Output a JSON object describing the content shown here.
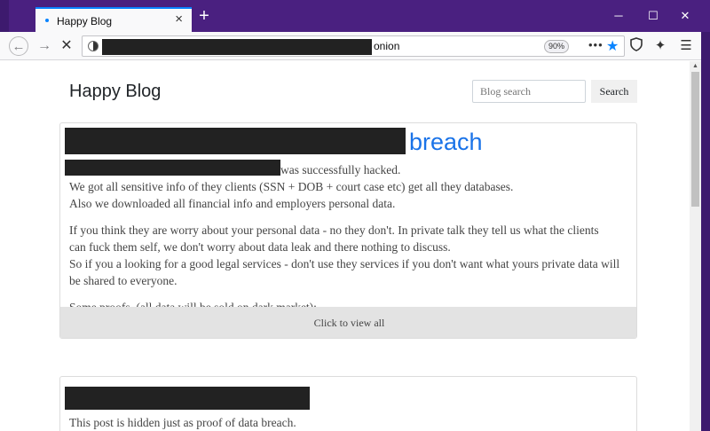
{
  "browser": {
    "tab_title": "Happy Blog",
    "new_tab_symbol": "+",
    "url_suffix": "onion",
    "zoom_level": "90%",
    "icons": [
      "back-icon",
      "forward-icon",
      "stop-icon",
      "site-info-icon",
      "page-actions-icon",
      "bookmark-star-icon",
      "tracking-shield-icon",
      "extension-icon",
      "menu-icon",
      "minimize-icon",
      "maximize-icon",
      "close-icon"
    ]
  },
  "header": {
    "title": "Happy Blog",
    "search_placeholder": "Blog search",
    "search_button": "Search"
  },
  "posts": [
    {
      "title_suffix": "breach",
      "hacked_line": "was successfully hacked.",
      "lines": [
        "We got all sensitive info of they clients (SSN + DOB + court case etc) get all they databases.",
        "Also we downloaded all financial info and employers personal data.",
        "If you think they are worry about your personal data - no they don't. In private talk they tell us what the clients",
        "can fuck them self, we don't worry about data leak and there nothing to discuss.",
        "So if you a looking for a good legal services - don't use they services if you don't want what yours private data will",
        "be shared to everyone.",
        "Some proofs. (all data will be sold on dark market):"
      ],
      "view_all": "Click to view all"
    },
    {
      "text": "This post is hidden just as proof of data breach."
    }
  ]
}
